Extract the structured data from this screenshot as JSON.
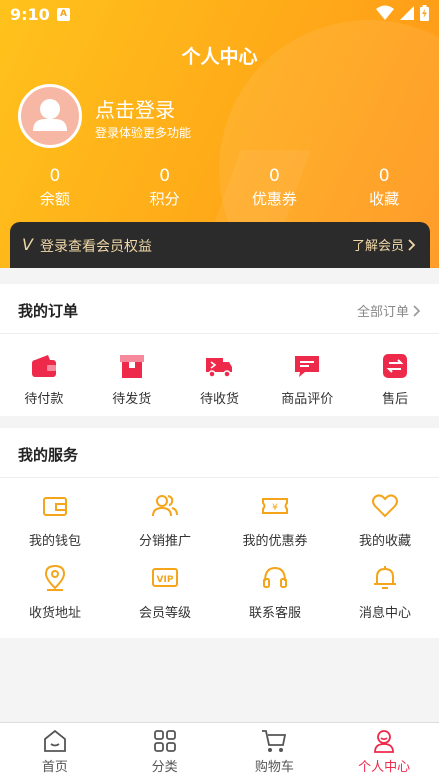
{
  "status_bar": {
    "time": "9:10",
    "app_badge": "A"
  },
  "header": {
    "title": "个人中心",
    "login_title": "点击登录",
    "login_subtitle": "登录体验更多功能"
  },
  "stats": [
    {
      "value": "0",
      "label": "余额"
    },
    {
      "value": "0",
      "label": "积分"
    },
    {
      "value": "0",
      "label": "优惠券"
    },
    {
      "value": "0",
      "label": "收藏"
    }
  ],
  "vip": {
    "letter": "V",
    "text": "登录查看会员权益",
    "more": "了解会员"
  },
  "orders": {
    "title": "我的订单",
    "all": "全部订单",
    "items": [
      {
        "label": "待付款",
        "icon": "wallet-icon"
      },
      {
        "label": "待发货",
        "icon": "box-icon"
      },
      {
        "label": "待收货",
        "icon": "truck-icon"
      },
      {
        "label": "商品评价",
        "icon": "comment-icon"
      },
      {
        "label": "售后",
        "icon": "exchange-icon"
      }
    ]
  },
  "services": {
    "title": "我的服务",
    "items": [
      {
        "label": "我的钱包",
        "icon": "wallet-outline-icon"
      },
      {
        "label": "分销推广",
        "icon": "users-icon"
      },
      {
        "label": "我的优惠券",
        "icon": "coupon-icon"
      },
      {
        "label": "我的收藏",
        "icon": "heart-icon"
      },
      {
        "label": "收货地址",
        "icon": "location-icon"
      },
      {
        "label": "会员等级",
        "icon": "vip-icon"
      },
      {
        "label": "联系客服",
        "icon": "headset-icon"
      },
      {
        "label": "消息中心",
        "icon": "bell-icon"
      }
    ]
  },
  "tabbar": [
    {
      "label": "首页",
      "icon": "home-icon"
    },
    {
      "label": "分类",
      "icon": "category-icon"
    },
    {
      "label": "购物车",
      "icon": "cart-icon"
    },
    {
      "label": "个人中心",
      "icon": "user-icon",
      "active": true
    }
  ],
  "colors": {
    "accent": "#ee2a4b",
    "header_start": "#ffc21c",
    "header_end": "#ff9418",
    "service_icon": "#f5a51c",
    "vip_bar": "#2b2b2b",
    "vip_text": "#f0d7a8"
  }
}
